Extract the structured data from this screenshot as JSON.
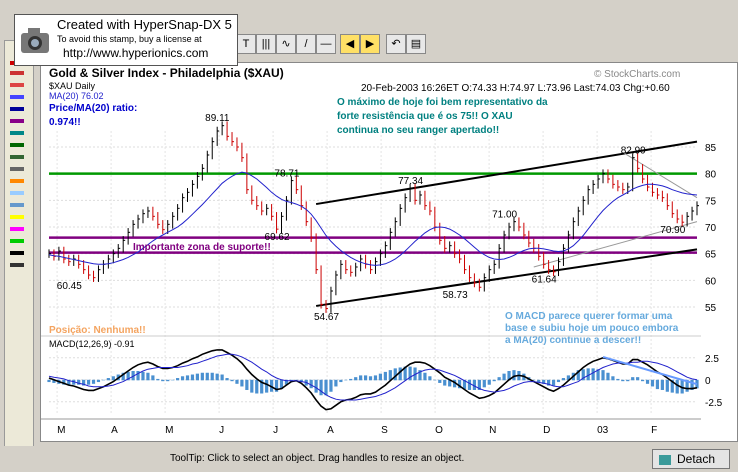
{
  "stamp": {
    "line1": "Created with HyperSnap-DX 5",
    "line2": "To avoid this stamp, buy a license at",
    "line3": "http://www.hyperionics.com"
  },
  "statusbar": {
    "tooltip": "ToolTip: Click to select an object. Drag handles to resize an object.",
    "detach_label": "Detach"
  },
  "colors": {
    "price_bar_up": "#000000",
    "price_bar_down": "#cc0000",
    "ma_line": "#2222cc",
    "resistance_line": "#009900",
    "support_line": "#800080",
    "channel_line": "#000000",
    "annotation_text": "#008080",
    "support_text": "#800080",
    "position_text": "#f4a460",
    "macd_comment_text": "#66aadd",
    "histogram": "#4a90d0"
  },
  "chart_data": {
    "type": "line",
    "title": "Gold & Silver Index - Philadelphia ($XAU)",
    "watermark": "© StockCharts.com",
    "header": "20-Feb-2003 16:26ET O:74.33 H:74.97 L:73.96 Last:74.03 Chg:+0.60",
    "legend_main": [
      "$XAU Daily",
      "MA(20) 76.02"
    ],
    "price_ma_label": "Price/MA(20) ratio:",
    "price_ma_value": "0.974!!",
    "annotation_main": "O máximo de hoje foi bem representativo da forte resistência que é os 75!! O XAU continua no seu ranger apertado!!",
    "support_label": "Importante zona de suporte!!",
    "position_label": "Posição: Nenhuma!!",
    "macd_label": "MACD(12,26,9) -0.91",
    "macd_comment": "O MACD parece querer formar uma base e subiu hoje um pouco embora a MA(20) continue a descer!!",
    "x_tick_labels": [
      "M",
      "A",
      "M",
      "J",
      "J",
      "A",
      "S",
      "O",
      "N",
      "D",
      "03",
      "F"
    ],
    "y_ticks": [
      55,
      60,
      65,
      70,
      75,
      80,
      85
    ],
    "ylim": [
      52,
      88
    ],
    "macd_ticks": [
      "2.5",
      "0",
      "-2.5"
    ],
    "macd_ylim": [
      -4,
      3.5
    ],
    "price_labels": [
      {
        "x": 4,
        "y": 60.45,
        "text": "60.45"
      },
      {
        "x": 34,
        "y": 89.11,
        "text": "89.11"
      },
      {
        "x": 48,
        "y": 78.71,
        "text": "78.71"
      },
      {
        "x": 46,
        "y": 69.62,
        "text": "69.62"
      },
      {
        "x": 56,
        "y": 54.67,
        "text": "54.67"
      },
      {
        "x": 73,
        "y": 77.34,
        "text": "77.34"
      },
      {
        "x": 82,
        "y": 58.73,
        "text": "58.73"
      },
      {
        "x": 92,
        "y": 71.0,
        "text": "71.00"
      },
      {
        "x": 100,
        "y": 61.64,
        "text": "61.64"
      },
      {
        "x": 118,
        "y": 82.99,
        "text": "82.99"
      },
      {
        "x": 126,
        "y": 70.9,
        "text": "70.90"
      }
    ],
    "horizontal_lines": [
      {
        "name": "resistance",
        "value": 80
      },
      {
        "name": "support-upper",
        "value": 68
      },
      {
        "name": "support-lower",
        "value": 65.2
      }
    ],
    "channel_lines": [
      {
        "name": "channel-upper",
        "x1": 54,
        "y1": 74.3,
        "x2": 131,
        "y2": 86
      },
      {
        "name": "channel-lower",
        "x1": 54,
        "y1": 55.2,
        "x2": 131,
        "y2": 65.8
      },
      {
        "name": "trend-upper-light",
        "x1": 116,
        "y1": 84,
        "x2": 131,
        "y2": 75.5
      },
      {
        "name": "trend-lower-light",
        "x1": 98,
        "y1": 62.5,
        "x2": 131,
        "y2": 71
      }
    ],
    "series": [
      {
        "name": "$XAU Daily",
        "x_count": 132,
        "values": [
          65.0,
          64.5,
          65.5,
          64.0,
          63.5,
          64.0,
          63.0,
          62.0,
          61.0,
          60.5,
          62.0,
          63.0,
          64.0,
          65.0,
          66.0,
          67.5,
          69.0,
          70.5,
          71.5,
          72.5,
          73.0,
          72.0,
          70.5,
          69.5,
          70.5,
          72.0,
          73.5,
          75.5,
          76.5,
          78.0,
          79.5,
          81.0,
          83.5,
          86.0,
          88.0,
          89.0,
          87.0,
          86.0,
          85.0,
          83.0,
          77.0,
          75.0,
          74.0,
          73.0,
          73.5,
          72.0,
          69.6,
          72.0,
          75.0,
          78.7,
          77.0,
          74.0,
          71.0,
          68.0,
          62.0,
          55.5,
          54.7,
          58.0,
          61.0,
          63.0,
          62.0,
          61.5,
          62.5,
          64.0,
          63.0,
          62.0,
          63.5,
          65.0,
          66.5,
          69.0,
          71.0,
          73.5,
          75.5,
          77.3,
          75.0,
          76.0,
          74.0,
          73.0,
          70.0,
          67.5,
          66.0,
          66.5,
          65.0,
          64.0,
          62.0,
          60.5,
          59.5,
          58.7,
          60.5,
          62.0,
          63.0,
          66.0,
          68.5,
          70.0,
          71.0,
          70.0,
          68.5,
          67.0,
          66.0,
          64.5,
          63.0,
          62.0,
          61.6,
          63.5,
          66.0,
          68.5,
          71.0,
          73.0,
          75.0,
          77.0,
          78.0,
          79.0,
          80.0,
          79.0,
          78.0,
          77.5,
          77.0,
          77.5,
          83.0,
          81.0,
          79.0,
          77.5,
          76.5,
          76.0,
          75.5,
          74.0,
          72.5,
          71.5,
          70.9,
          72.0,
          73.0,
          74.0
        ]
      },
      {
        "name": "MA(20)",
        "x_count": 132,
        "values": [
          64.8,
          64.6,
          64.5,
          64.3,
          64.1,
          63.9,
          63.7,
          63.5,
          63.3,
          63.1,
          63.0,
          63.0,
          63.1,
          63.3,
          63.6,
          63.9,
          64.3,
          64.8,
          65.3,
          66.0,
          66.7,
          67.4,
          68.0,
          68.5,
          69.0,
          69.5,
          70.0,
          70.7,
          71.5,
          72.4,
          73.3,
          74.2,
          75.2,
          76.2,
          77.2,
          78.2,
          78.9,
          79.5,
          80.0,
          80.3,
          80.1,
          79.6,
          79.0,
          78.2,
          77.4,
          76.5,
          75.8,
          75.2,
          74.8,
          74.6,
          74.3,
          73.9,
          73.3,
          72.4,
          71.2,
          69.8,
          68.4,
          67.3,
          66.4,
          65.6,
          64.9,
          64.3,
          63.8,
          63.4,
          63.1,
          62.9,
          62.8,
          62.9,
          63.1,
          63.5,
          64.0,
          64.7,
          65.5,
          66.4,
          67.3,
          68.1,
          68.9,
          69.5,
          69.9,
          70.0,
          69.9,
          69.6,
          69.1,
          68.5,
          67.8,
          67.0,
          66.2,
          65.4,
          64.8,
          64.3,
          64.0,
          63.9,
          64.0,
          64.3,
          64.7,
          65.2,
          65.6,
          65.9,
          66.0,
          66.0,
          65.9,
          65.7,
          65.5,
          65.4,
          65.5,
          65.9,
          66.5,
          67.4,
          68.4,
          69.6,
          70.8,
          72.0,
          73.1,
          74.0,
          74.8,
          75.5,
          76.0,
          76.5,
          77.1,
          77.5,
          77.8,
          78.0,
          78.0,
          77.9,
          77.7,
          77.4,
          77.0,
          76.7,
          76.4,
          76.2,
          76.1,
          76.0
        ]
      },
      {
        "name": "MACD(12,26,9)",
        "x_count": 132,
        "values": [
          0.2,
          0.0,
          -0.2,
          -0.4,
          -0.6,
          -0.7,
          -0.9,
          -1.1,
          -1.2,
          -1.2,
          -1.0,
          -0.8,
          -0.5,
          -0.2,
          0.2,
          0.6,
          1.0,
          1.4,
          1.7,
          1.9,
          2.0,
          1.8,
          1.5,
          1.3,
          1.3,
          1.4,
          1.6,
          1.9,
          2.1,
          2.4,
          2.6,
          2.9,
          3.1,
          3.3,
          3.4,
          3.4,
          3.1,
          2.8,
          2.4,
          1.9,
          1.2,
          0.6,
          0.1,
          -0.3,
          -0.5,
          -0.8,
          -1.1,
          -1.0,
          -0.6,
          -0.2,
          -0.1,
          -0.4,
          -0.9,
          -1.5,
          -2.3,
          -3.0,
          -3.4,
          -3.3,
          -2.9,
          -2.5,
          -2.3,
          -2.2,
          -2.0,
          -1.7,
          -1.6,
          -1.6,
          -1.4,
          -1.0,
          -0.6,
          -0.1,
          0.4,
          0.9,
          1.4,
          1.8,
          2.0,
          2.0,
          1.9,
          1.6,
          1.2,
          0.8,
          0.3,
          0.0,
          -0.3,
          -0.7,
          -1.1,
          -1.5,
          -1.8,
          -2.1,
          -2.0,
          -1.8,
          -1.5,
          -1.0,
          -0.5,
          0.0,
          0.4,
          0.5,
          0.4,
          0.1,
          -0.2,
          -0.5,
          -0.8,
          -1.1,
          -1.3,
          -1.0,
          -0.6,
          -0.1,
          0.4,
          0.9,
          1.4,
          1.8,
          2.1,
          2.3,
          2.5,
          2.4,
          2.2,
          2.0,
          1.8,
          1.8,
          2.3,
          2.3,
          2.0,
          1.7,
          1.3,
          0.9,
          0.6,
          0.2,
          -0.2,
          -0.6,
          -0.9,
          -1.0,
          -1.0,
          -0.91
        ]
      },
      {
        "name": "MACD Signal",
        "x_count": 132,
        "values": [
          0.4,
          0.3,
          0.2,
          0.1,
          -0.1,
          -0.2,
          -0.4,
          -0.5,
          -0.7,
          -0.8,
          -0.8,
          -0.8,
          -0.7,
          -0.6,
          -0.4,
          -0.2,
          0.1,
          0.4,
          0.7,
          1.0,
          1.2,
          1.3,
          1.4,
          1.4,
          1.4,
          1.4,
          1.4,
          1.5,
          1.6,
          1.8,
          1.9,
          2.1,
          2.3,
          2.5,
          2.7,
          2.8,
          2.9,
          2.9,
          2.8,
          2.6,
          2.3,
          2.0,
          1.6,
          1.2,
          0.9,
          0.5,
          0.2,
          0.0,
          -0.1,
          -0.1,
          -0.1,
          -0.2,
          -0.3,
          -0.6,
          -0.9,
          -1.3,
          -1.7,
          -2.0,
          -2.2,
          -2.3,
          -2.3,
          -2.3,
          -2.3,
          -2.2,
          -2.1,
          -2.0,
          -1.9,
          -1.7,
          -1.5,
          -1.2,
          -0.9,
          -0.5,
          -0.1,
          0.3,
          0.6,
          0.9,
          1.1,
          1.2,
          1.2,
          1.1,
          0.9,
          0.7,
          0.5,
          0.2,
          -0.1,
          -0.4,
          -0.7,
          -1.0,
          -1.2,
          -1.3,
          -1.4,
          -1.3,
          -1.2,
          -1.0,
          -0.7,
          -0.5,
          -0.3,
          -0.2,
          -0.2,
          -0.3,
          -0.4,
          -0.5,
          -0.7,
          -0.8,
          -0.8,
          -0.6,
          -0.4,
          -0.2,
          0.2,
          0.5,
          0.8,
          1.1,
          1.4,
          1.6,
          1.8,
          1.9,
          1.9,
          1.9,
          2.0,
          2.0,
          2.1,
          2.1,
          2.0,
          1.9,
          1.7,
          1.5,
          1.2,
          0.9,
          0.6,
          0.3,
          0.1,
          0.0
        ]
      }
    ]
  }
}
